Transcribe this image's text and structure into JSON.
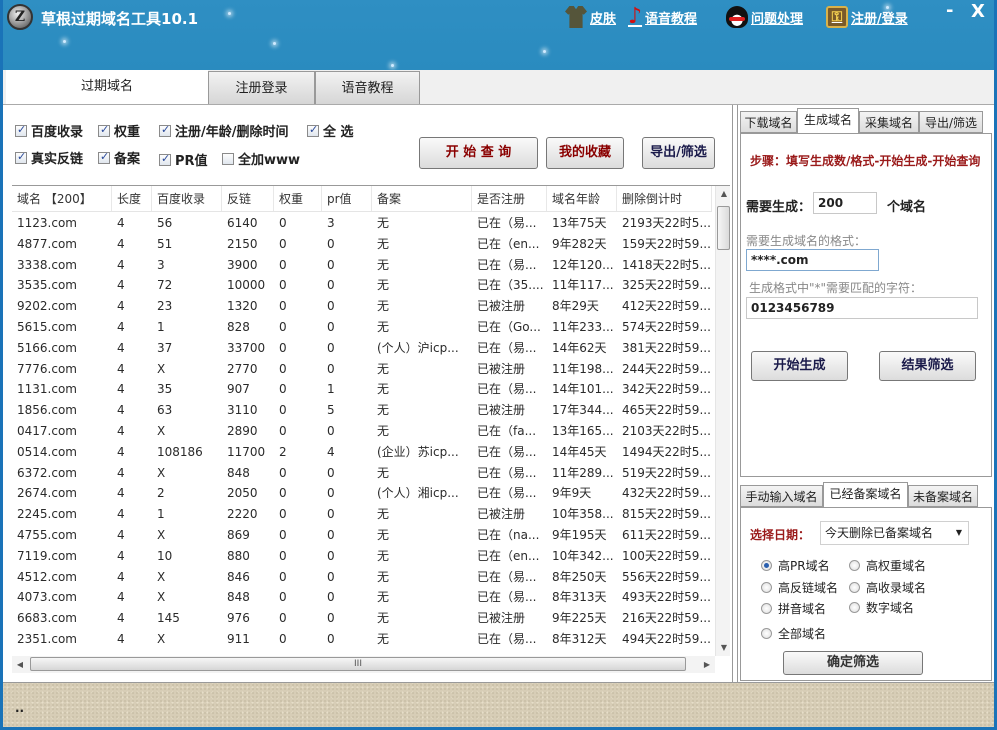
{
  "app": {
    "title": "草根过期域名工具10.1",
    "logo_letter": "Z",
    "top_links": [
      {
        "icon": "shirt-icon",
        "label": "皮肤"
      },
      {
        "icon": "music-note-icon",
        "label": "语音教程"
      },
      {
        "icon": "qq-penguin-icon",
        "label": "问题处理"
      },
      {
        "icon": "key-icon",
        "label": "注册/登录"
      }
    ],
    "minimize_label": "-",
    "close_label": "X"
  },
  "main_tabs": [
    {
      "label": "过期域名",
      "active": true
    },
    {
      "label": "注册登录",
      "active": false
    },
    {
      "label": "语音教程",
      "active": false
    }
  ],
  "options": {
    "checkboxes": [
      {
        "label": "百度收录",
        "checked": true
      },
      {
        "label": "权重",
        "checked": true
      },
      {
        "label": "注册/年龄/删除时间",
        "checked": true
      },
      {
        "label": "全 选",
        "checked": true
      },
      {
        "label": "真实反链",
        "checked": true
      },
      {
        "label": "备案",
        "checked": true
      },
      {
        "label": "PR值",
        "checked": true
      },
      {
        "label": "全加www",
        "checked": false
      }
    ],
    "buttons": {
      "start_query": "开 始 查 询",
      "favorites": "我的收藏",
      "export_filter": "导出/筛选"
    }
  },
  "table": {
    "columns": [
      "域名  【200】",
      "长度",
      "百度收录",
      "反链",
      "权重",
      "pr值",
      "备案",
      "是否注册",
      "域名年龄",
      "删除倒计时"
    ],
    "rows": [
      [
        "1123.com",
        "4",
        "56",
        "6140",
        "0",
        "3",
        "无",
        "已在（易...",
        "13年75天",
        "2193天22时5..."
      ],
      [
        "4877.com",
        "4",
        "51",
        "2150",
        "0",
        "0",
        "无",
        "已在（en...",
        "9年282天",
        "159天22时59..."
      ],
      [
        "3338.com",
        "4",
        "3",
        "3900",
        "0",
        "0",
        "无",
        "已在（易...",
        "12年120...",
        "1418天22时5..."
      ],
      [
        "3535.com",
        "4",
        "72",
        "10000",
        "0",
        "0",
        "无",
        "已在（35....",
        "11年117...",
        "325天22时59..."
      ],
      [
        "9202.com",
        "4",
        "23",
        "1320",
        "0",
        "0",
        "无",
        "已被注册",
        "8年29天",
        "412天22时59..."
      ],
      [
        "5615.com",
        "4",
        "1",
        "828",
        "0",
        "0",
        "无",
        "已在（Go...",
        "11年233...",
        "574天22时59..."
      ],
      [
        "5166.com",
        "4",
        "37",
        "33700",
        "0",
        "0",
        "(个人）沪icp...",
        "已在（易...",
        "14年62天",
        "381天22时59..."
      ],
      [
        "7776.com",
        "4",
        "X",
        "2770",
        "0",
        "0",
        "无",
        "已被注册",
        "11年198...",
        "244天22时59..."
      ],
      [
        "1131.com",
        "4",
        "35",
        "907",
        "0",
        "1",
        "无",
        "已在（易...",
        "14年101...",
        "342天22时59..."
      ],
      [
        "1856.com",
        "4",
        "63",
        "3110",
        "0",
        "5",
        "无",
        "已被注册",
        "17年344...",
        "465天22时59..."
      ],
      [
        "0417.com",
        "4",
        "X",
        "2890",
        "0",
        "0",
        "无",
        "已在（fa...",
        "13年165...",
        "2103天22时5..."
      ],
      [
        "0514.com",
        "4",
        "108186",
        "11700",
        "2",
        "4",
        "(企业）苏icp...",
        "已在（易...",
        "14年45天",
        "1494天22时5..."
      ],
      [
        "6372.com",
        "4",
        "X",
        "848",
        "0",
        "0",
        "无",
        "已在（易...",
        "11年289...",
        "519天22时59..."
      ],
      [
        "2674.com",
        "4",
        "2",
        "2050",
        "0",
        "0",
        "(个人）湘icp...",
        "已在（易...",
        "9年9天",
        "432天22时59..."
      ],
      [
        "2245.com",
        "4",
        "1",
        "2220",
        "0",
        "0",
        "无",
        "已被注册",
        "10年358...",
        "815天22时59..."
      ],
      [
        "4755.com",
        "4",
        "X",
        "869",
        "0",
        "0",
        "无",
        "已在（na...",
        "9年195天",
        "611天22时59..."
      ],
      [
        "7119.com",
        "4",
        "10",
        "880",
        "0",
        "0",
        "无",
        "已在（en...",
        "10年342...",
        "100天22时59..."
      ],
      [
        "4512.com",
        "4",
        "X",
        "846",
        "0",
        "0",
        "无",
        "已在（易...",
        "8年250天",
        "556天22时59..."
      ],
      [
        "4073.com",
        "4",
        "X",
        "848",
        "0",
        "0",
        "无",
        "已在（易...",
        "8年313天",
        "493天22时59..."
      ],
      [
        "6683.com",
        "4",
        "145",
        "976",
        "0",
        "0",
        "无",
        "已被注册",
        "9年225天",
        "216天22时59..."
      ],
      [
        "2351.com",
        "4",
        "X",
        "911",
        "0",
        "0",
        "无",
        "已在（易...",
        "8年312天",
        "494天22时59..."
      ]
    ],
    "hscroll_grip": "III"
  },
  "generator": {
    "tabs": [
      {
        "label": "下载域名",
        "active": false
      },
      {
        "label": "生成域名",
        "active": true
      },
      {
        "label": "采集域名",
        "active": false
      },
      {
        "label": "导出/筛选",
        "active": false
      }
    ],
    "steps": "步骤：填写生成数/格式-开始生成-开始查询",
    "count_label": "需要生成：",
    "count_value": "200",
    "count_unit": "个域名",
    "format_label": "需要生成域名的格式：",
    "format_value": "****.com",
    "chars_label": "生成格式中\"*\"需要匹配的字符：",
    "chars_value": "0123456789",
    "start_button": "开始生成",
    "filter_button": "结果筛选"
  },
  "filter": {
    "tabs": [
      {
        "label": "手动输入域名",
        "active": false
      },
      {
        "label": "已经备案域名",
        "active": true
      },
      {
        "label": "未备案域名",
        "active": false
      }
    ],
    "date_label": "选择日期：",
    "date_selected": "今天删除已备案域名",
    "radios": [
      {
        "label": "高PR域名",
        "checked": true
      },
      {
        "label": "高权重域名",
        "checked": false
      },
      {
        "label": "高反链域名",
        "checked": false
      },
      {
        "label": "高收录域名",
        "checked": false
      },
      {
        "label": "拼音域名",
        "checked": false
      },
      {
        "label": "数字域名",
        "checked": false
      },
      {
        "label": "全部域名",
        "checked": false
      }
    ],
    "confirm_button": "确定筛选"
  },
  "status": {
    "text": ".."
  }
}
